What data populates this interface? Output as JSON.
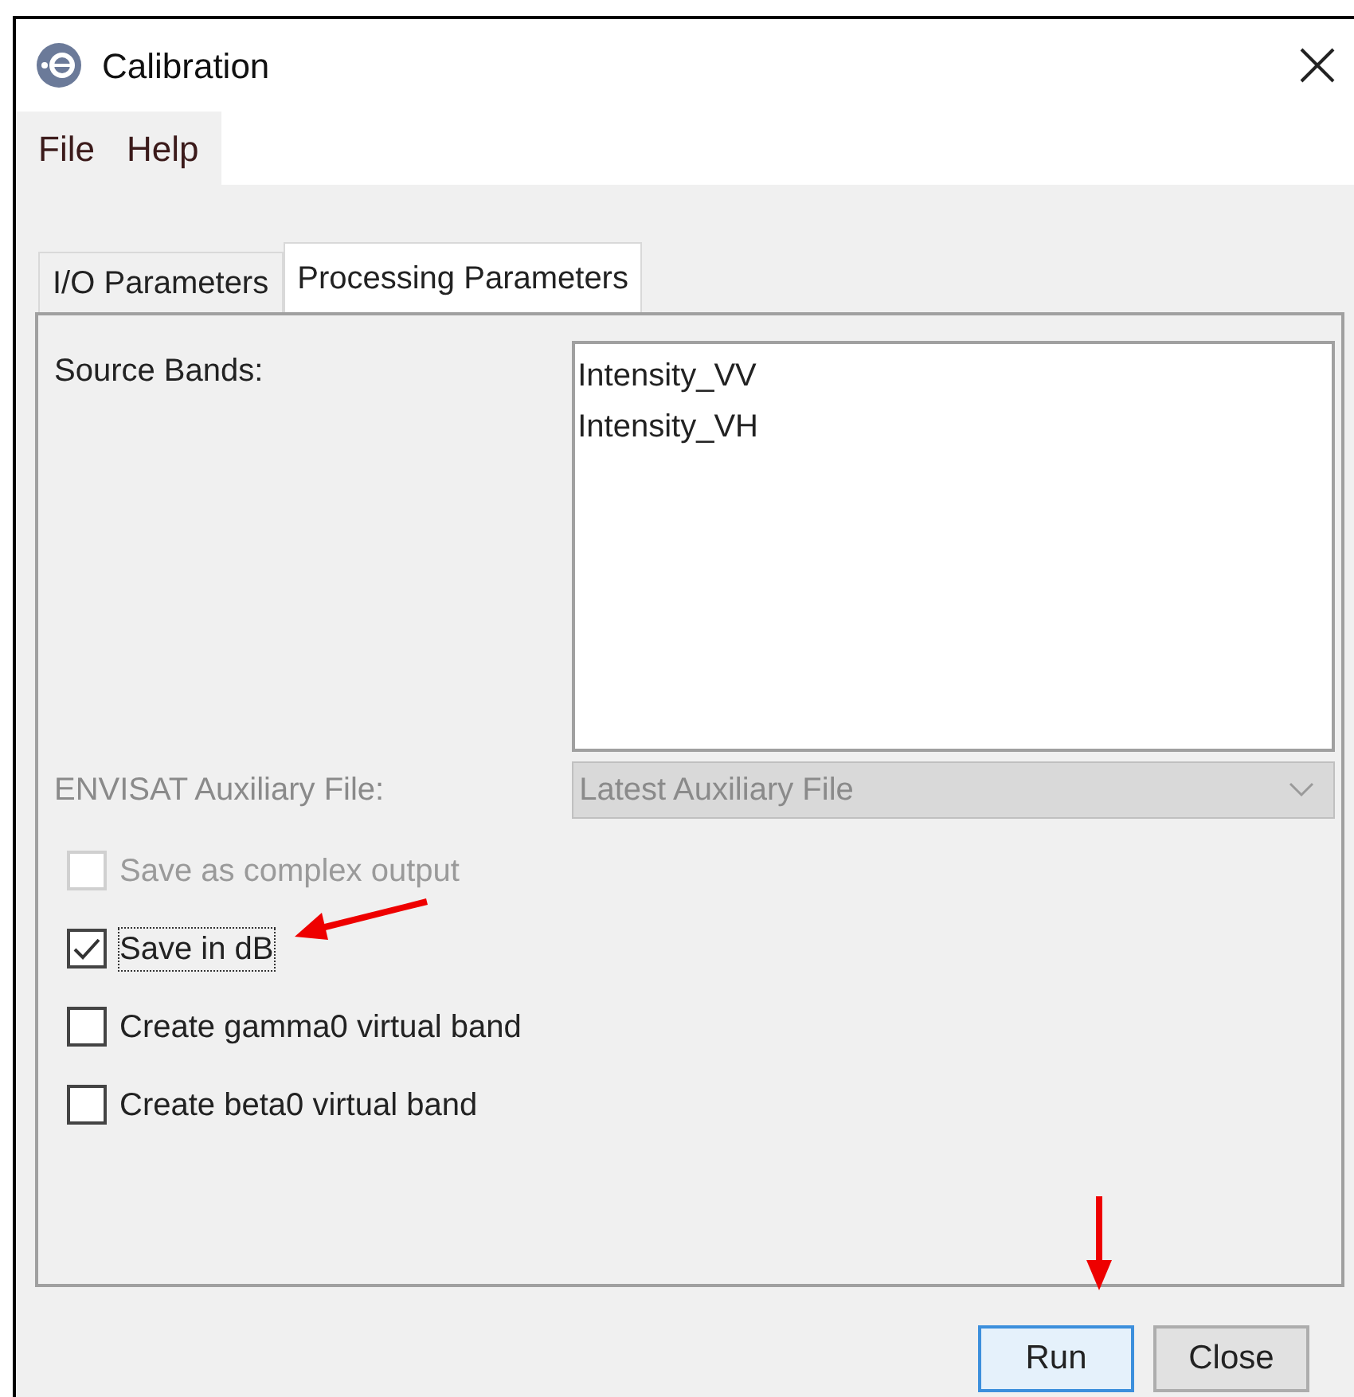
{
  "window": {
    "title": "Calibration"
  },
  "menu": [
    "File",
    "Help"
  ],
  "tabs": [
    {
      "label": "I/O Parameters",
      "selected": false
    },
    {
      "label": "Processing Parameters",
      "selected": true
    }
  ],
  "source_bands": {
    "label": "Source Bands:",
    "items": [
      "Intensity_VV",
      "Intensity_VH"
    ]
  },
  "auxiliary_file": {
    "label": "ENVISAT Auxiliary File:",
    "value": "Latest Auxiliary File",
    "disabled": true
  },
  "options": [
    {
      "label": "Save as complex output",
      "checked": false,
      "disabled": true,
      "focused": false
    },
    {
      "label": "Save in dB",
      "checked": true,
      "disabled": false,
      "focused": true
    },
    {
      "label": "Create gamma0 virtual band",
      "checked": false,
      "disabled": false,
      "focused": false
    },
    {
      "label": "Create beta0 virtual band",
      "checked": false,
      "disabled": false,
      "focused": false
    }
  ],
  "buttons": [
    {
      "label": "Run",
      "selected": true
    },
    {
      "label": "Close",
      "selected": false
    }
  ]
}
